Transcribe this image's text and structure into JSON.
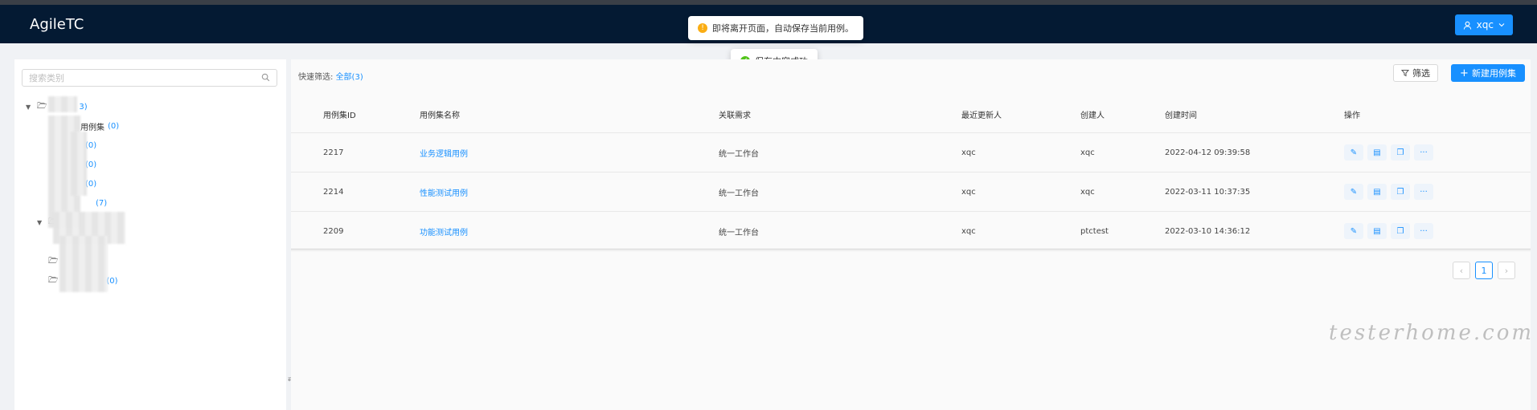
{
  "app": {
    "title": "AgileTC"
  },
  "user": {
    "name": "xqc"
  },
  "toasts": {
    "warning": "即将离开页面，自动保存当前用例。",
    "success": "保存内容成功"
  },
  "sidebar": {
    "search_placeholder": "搜索类别",
    "tree": [
      {
        "label": "",
        "count": "3)"
      },
      {
        "label": "用例集",
        "count": "(0)"
      },
      {
        "label": "",
        "count": "(0)"
      },
      {
        "label": "",
        "count": "(0)"
      },
      {
        "label": "",
        "count": "(0)"
      },
      {
        "label": "",
        "count": "(7)"
      },
      {
        "label": "",
        "count": "(0)"
      }
    ]
  },
  "toolbar": {
    "quick_filter_label": "快速筛选:",
    "quick_filter_all": "全部(3)",
    "filter_label": "筛选",
    "new_label": "新建用例集"
  },
  "table": {
    "columns": [
      "用例集ID",
      "用例集名称",
      "关联需求",
      "最近更新人",
      "创建人",
      "创建时间",
      "操作"
    ],
    "rows": [
      {
        "id": "2217",
        "name": "业务逻辑用例",
        "requirement": "统一工作台",
        "updater": "xqc",
        "creator": "xqc",
        "created": "2022-04-12 09:39:58"
      },
      {
        "id": "2214",
        "name": "性能测试用例",
        "requirement": "统一工作台",
        "updater": "xqc",
        "creator": "xqc",
        "created": "2022-03-11 10:37:35"
      },
      {
        "id": "2209",
        "name": "功能测试用例",
        "requirement": "统一工作台",
        "updater": "xqc",
        "creator": "ptctest",
        "created": "2022-03-10 14:36:12"
      }
    ]
  },
  "pagination": {
    "current": "1",
    "prev": "‹",
    "next": "›"
  },
  "watermark": "testerhome.com"
}
